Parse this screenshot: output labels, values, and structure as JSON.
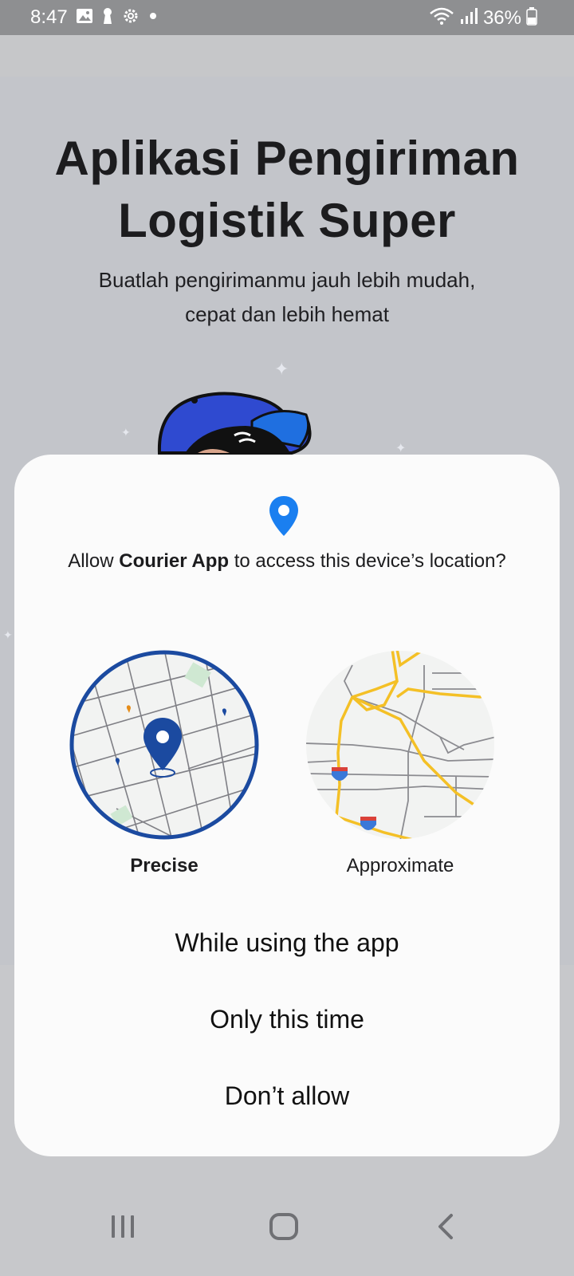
{
  "status_bar": {
    "time": "8:47",
    "battery_percent": "36%",
    "icons_left": [
      "image-icon",
      "keyhole-icon",
      "settings-icon",
      "dot-icon"
    ],
    "icons_right": [
      "wifi-icon",
      "signal-icon",
      "battery-icon"
    ]
  },
  "background_app": {
    "title_line1": "Aplikasi Pengiriman",
    "title_line2": "Logistik Super",
    "subtitle_line1": "Buatlah pengirimanmu jauh lebih mudah,",
    "subtitle_line2": "cepat dan lebih hemat"
  },
  "permission_dialog": {
    "question_prefix": "Allow ",
    "app_name": "Courier App",
    "question_suffix": " to access this device’s location?",
    "options": [
      {
        "label": "Precise",
        "selected": true
      },
      {
        "label": "Approximate",
        "selected": false
      }
    ],
    "buttons": {
      "while_using": "While using the app",
      "only_this_time": "Only this time",
      "dont_allow": "Don’t allow"
    },
    "colors": {
      "accent_blue": "#1a73e8",
      "precise_ring": "#1b4aa0",
      "road_yellow": "#f4c026"
    }
  },
  "nav_bar": {
    "buttons": [
      "recent-apps-icon",
      "home-icon",
      "back-icon"
    ]
  }
}
